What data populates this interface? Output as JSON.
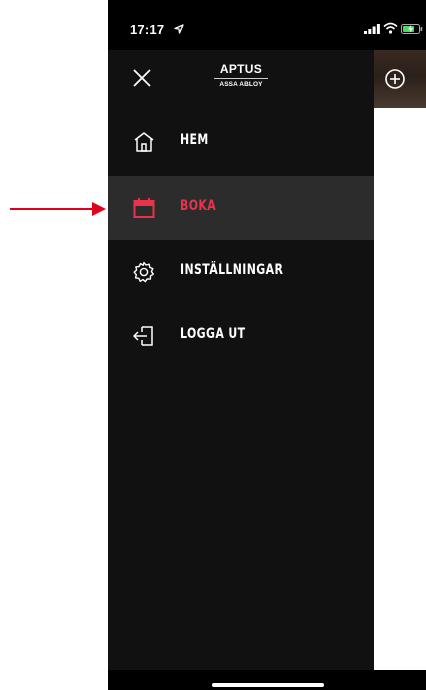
{
  "status_bar": {
    "time": "17:17"
  },
  "header": {
    "brand_name": "APTUS",
    "brand_sub": "ASSA ABLOY"
  },
  "menu": {
    "items": [
      {
        "label": "HEM",
        "icon": "home-icon",
        "active": false
      },
      {
        "label": "BOKA",
        "icon": "calendar-icon",
        "active": true
      },
      {
        "label": "INSTÄLLNINGAR",
        "icon": "gear-icon",
        "active": false
      },
      {
        "label": "LOGGA UT",
        "icon": "logout-icon",
        "active": false
      }
    ]
  },
  "colors": {
    "drawer_bg": "#111111",
    "active_row_bg": "#2c2c2c",
    "accent": "#e8344a",
    "annotation_arrow": "#e0001b"
  }
}
